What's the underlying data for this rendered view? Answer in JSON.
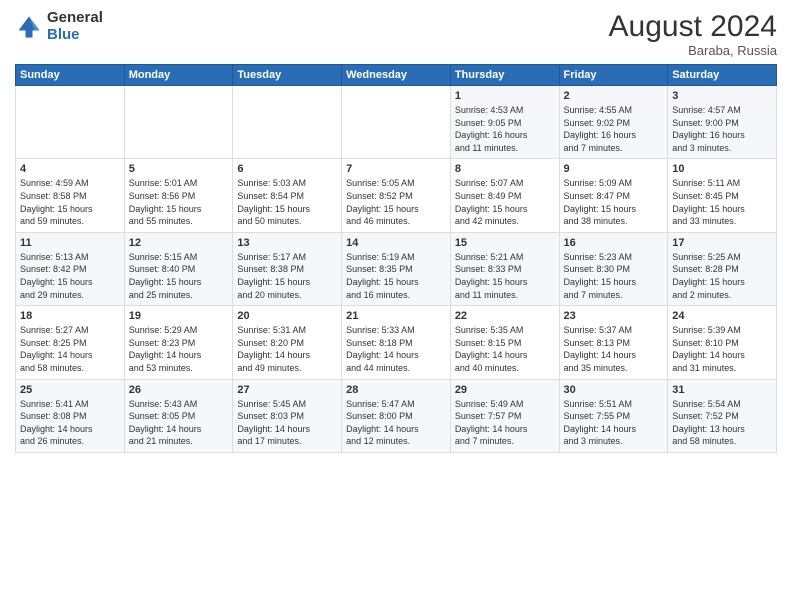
{
  "header": {
    "logo_general": "General",
    "logo_blue": "Blue",
    "month_title": "August 2024",
    "location": "Baraba, Russia"
  },
  "weekdays": [
    "Sunday",
    "Monday",
    "Tuesday",
    "Wednesday",
    "Thursday",
    "Friday",
    "Saturday"
  ],
  "weeks": [
    [
      {
        "day": "",
        "info": ""
      },
      {
        "day": "",
        "info": ""
      },
      {
        "day": "",
        "info": ""
      },
      {
        "day": "",
        "info": ""
      },
      {
        "day": "1",
        "info": "Sunrise: 4:53 AM\nSunset: 9:05 PM\nDaylight: 16 hours\nand 11 minutes."
      },
      {
        "day": "2",
        "info": "Sunrise: 4:55 AM\nSunset: 9:02 PM\nDaylight: 16 hours\nand 7 minutes."
      },
      {
        "day": "3",
        "info": "Sunrise: 4:57 AM\nSunset: 9:00 PM\nDaylight: 16 hours\nand 3 minutes."
      }
    ],
    [
      {
        "day": "4",
        "info": "Sunrise: 4:59 AM\nSunset: 8:58 PM\nDaylight: 15 hours\nand 59 minutes."
      },
      {
        "day": "5",
        "info": "Sunrise: 5:01 AM\nSunset: 8:56 PM\nDaylight: 15 hours\nand 55 minutes."
      },
      {
        "day": "6",
        "info": "Sunrise: 5:03 AM\nSunset: 8:54 PM\nDaylight: 15 hours\nand 50 minutes."
      },
      {
        "day": "7",
        "info": "Sunrise: 5:05 AM\nSunset: 8:52 PM\nDaylight: 15 hours\nand 46 minutes."
      },
      {
        "day": "8",
        "info": "Sunrise: 5:07 AM\nSunset: 8:49 PM\nDaylight: 15 hours\nand 42 minutes."
      },
      {
        "day": "9",
        "info": "Sunrise: 5:09 AM\nSunset: 8:47 PM\nDaylight: 15 hours\nand 38 minutes."
      },
      {
        "day": "10",
        "info": "Sunrise: 5:11 AM\nSunset: 8:45 PM\nDaylight: 15 hours\nand 33 minutes."
      }
    ],
    [
      {
        "day": "11",
        "info": "Sunrise: 5:13 AM\nSunset: 8:42 PM\nDaylight: 15 hours\nand 29 minutes."
      },
      {
        "day": "12",
        "info": "Sunrise: 5:15 AM\nSunset: 8:40 PM\nDaylight: 15 hours\nand 25 minutes."
      },
      {
        "day": "13",
        "info": "Sunrise: 5:17 AM\nSunset: 8:38 PM\nDaylight: 15 hours\nand 20 minutes."
      },
      {
        "day": "14",
        "info": "Sunrise: 5:19 AM\nSunset: 8:35 PM\nDaylight: 15 hours\nand 16 minutes."
      },
      {
        "day": "15",
        "info": "Sunrise: 5:21 AM\nSunset: 8:33 PM\nDaylight: 15 hours\nand 11 minutes."
      },
      {
        "day": "16",
        "info": "Sunrise: 5:23 AM\nSunset: 8:30 PM\nDaylight: 15 hours\nand 7 minutes."
      },
      {
        "day": "17",
        "info": "Sunrise: 5:25 AM\nSunset: 8:28 PM\nDaylight: 15 hours\nand 2 minutes."
      }
    ],
    [
      {
        "day": "18",
        "info": "Sunrise: 5:27 AM\nSunset: 8:25 PM\nDaylight: 14 hours\nand 58 minutes."
      },
      {
        "day": "19",
        "info": "Sunrise: 5:29 AM\nSunset: 8:23 PM\nDaylight: 14 hours\nand 53 minutes."
      },
      {
        "day": "20",
        "info": "Sunrise: 5:31 AM\nSunset: 8:20 PM\nDaylight: 14 hours\nand 49 minutes."
      },
      {
        "day": "21",
        "info": "Sunrise: 5:33 AM\nSunset: 8:18 PM\nDaylight: 14 hours\nand 44 minutes."
      },
      {
        "day": "22",
        "info": "Sunrise: 5:35 AM\nSunset: 8:15 PM\nDaylight: 14 hours\nand 40 minutes."
      },
      {
        "day": "23",
        "info": "Sunrise: 5:37 AM\nSunset: 8:13 PM\nDaylight: 14 hours\nand 35 minutes."
      },
      {
        "day": "24",
        "info": "Sunrise: 5:39 AM\nSunset: 8:10 PM\nDaylight: 14 hours\nand 31 minutes."
      }
    ],
    [
      {
        "day": "25",
        "info": "Sunrise: 5:41 AM\nSunset: 8:08 PM\nDaylight: 14 hours\nand 26 minutes."
      },
      {
        "day": "26",
        "info": "Sunrise: 5:43 AM\nSunset: 8:05 PM\nDaylight: 14 hours\nand 21 minutes."
      },
      {
        "day": "27",
        "info": "Sunrise: 5:45 AM\nSunset: 8:03 PM\nDaylight: 14 hours\nand 17 minutes."
      },
      {
        "day": "28",
        "info": "Sunrise: 5:47 AM\nSunset: 8:00 PM\nDaylight: 14 hours\nand 12 minutes."
      },
      {
        "day": "29",
        "info": "Sunrise: 5:49 AM\nSunset: 7:57 PM\nDaylight: 14 hours\nand 7 minutes."
      },
      {
        "day": "30",
        "info": "Sunrise: 5:51 AM\nSunset: 7:55 PM\nDaylight: 14 hours\nand 3 minutes."
      },
      {
        "day": "31",
        "info": "Sunrise: 5:54 AM\nSunset: 7:52 PM\nDaylight: 13 hours\nand 58 minutes."
      }
    ]
  ]
}
